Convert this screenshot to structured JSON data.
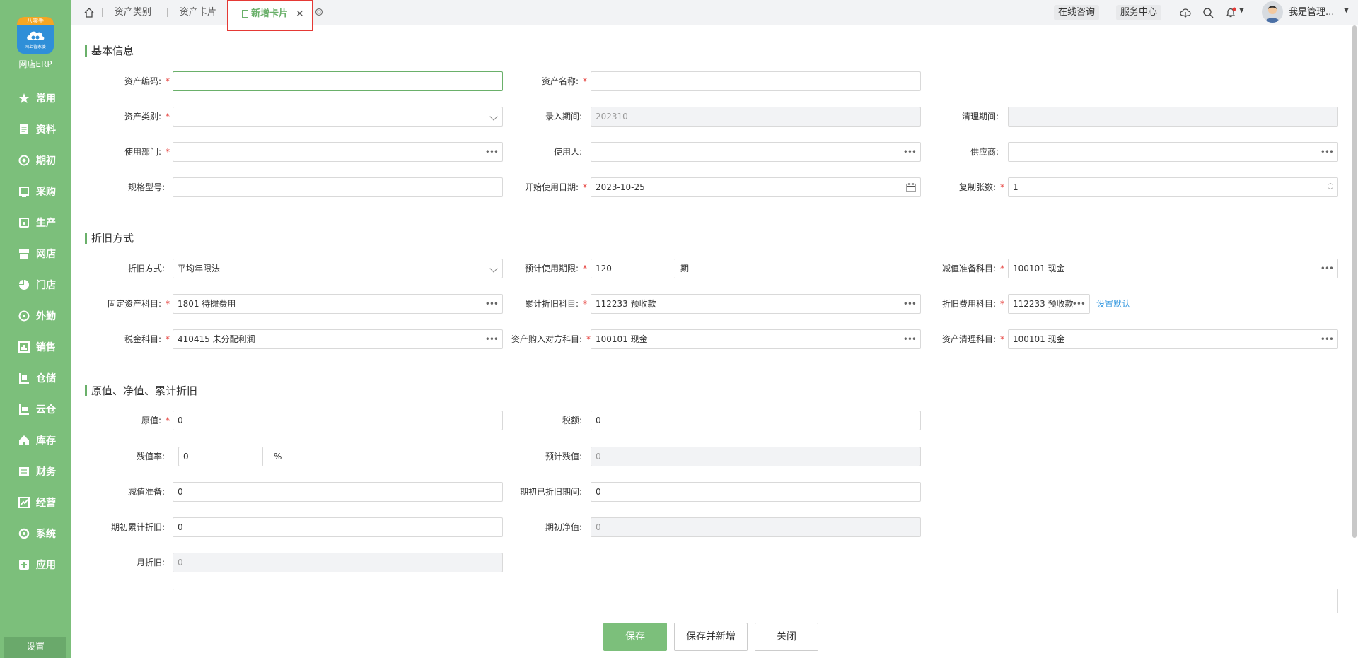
{
  "app": {
    "title": "网店ERP",
    "logo_ribbon": "八零手",
    "logo_sub": "网上管家婆"
  },
  "sidebar": {
    "items": [
      {
        "label": "常用",
        "icon": "star-icon"
      },
      {
        "label": "资料",
        "icon": "file-icon"
      },
      {
        "label": "期初",
        "icon": "target-icon"
      },
      {
        "label": "采购",
        "icon": "cart-icon"
      },
      {
        "label": "生产",
        "icon": "factory-icon"
      },
      {
        "label": "网店",
        "icon": "shop-icon"
      },
      {
        "label": "门店",
        "icon": "pie-icon"
      },
      {
        "label": "外勤",
        "icon": "location-icon"
      },
      {
        "label": "销售",
        "icon": "chart-icon"
      },
      {
        "label": "仓储",
        "icon": "warehouse-icon"
      },
      {
        "label": "云仓",
        "icon": "cloud-warehouse-icon"
      },
      {
        "label": "库存",
        "icon": "house-icon"
      },
      {
        "label": "财务",
        "icon": "money-icon"
      },
      {
        "label": "经营",
        "icon": "trend-icon"
      },
      {
        "label": "系统",
        "icon": "gear-icon"
      },
      {
        "label": "应用",
        "icon": "plus-box-icon"
      }
    ],
    "settings_label": "设置"
  },
  "tabs": {
    "items": [
      "资产类别",
      "资产卡片"
    ],
    "active": "新增卡片",
    "close": "✕"
  },
  "topbar": {
    "consult": "在线咨询",
    "service": "服务中心",
    "user": "我是管理...",
    "notify_color": "#e53935"
  },
  "sections": {
    "basic": "基本信息",
    "depreciation": "折旧方式",
    "values": "原值、净值、累计折旧"
  },
  "basic": {
    "asset_code": {
      "label": "资产编码:",
      "value": ""
    },
    "asset_name": {
      "label": "资产名称:",
      "value": ""
    },
    "asset_category": {
      "label": "资产类别:",
      "value": ""
    },
    "entry_period": {
      "label": "录入期间:",
      "value": "202310"
    },
    "clear_period": {
      "label": "清理期间:",
      "value": ""
    },
    "department": {
      "label": "使用部门:",
      "value": ""
    },
    "user": {
      "label": "使用人:",
      "value": ""
    },
    "supplier": {
      "label": "供应商:",
      "value": ""
    },
    "spec": {
      "label": "规格型号:",
      "value": ""
    },
    "start_date": {
      "label": "开始使用日期:",
      "value": "2023-10-25"
    },
    "copies": {
      "label": "复制张数:",
      "value": "1"
    }
  },
  "depr": {
    "method": {
      "label": "折旧方式:",
      "value": "平均年限法"
    },
    "life": {
      "label": "预计使用期限:",
      "value": "120",
      "unit": "期"
    },
    "impairment_acct": {
      "label": "减值准备科目:",
      "value": "100101 现金"
    },
    "fixed_acct": {
      "label": "固定资产科目:",
      "value": "1801 待摊费用"
    },
    "accum_acct": {
      "label": "累计折旧科目:",
      "value": "112233 预收款"
    },
    "expense_acct": {
      "label": "折旧费用科目:",
      "value": "112233 预收款",
      "link": "设置默认"
    },
    "tax_acct": {
      "label": "税金科目:",
      "value": "410415 未分配利润"
    },
    "purchase_acct": {
      "label": "资产购入对方科目:",
      "value": "100101 现金"
    },
    "clear_acct": {
      "label": "资产清理科目:",
      "value": "100101 现金"
    }
  },
  "values": {
    "original": {
      "label": "原值:",
      "value": "0"
    },
    "tax": {
      "label": "税额:",
      "value": "0"
    },
    "residual_rate": {
      "label": "残值率:",
      "value": "0",
      "unit": "%"
    },
    "est_residual": {
      "label": "预计残值:",
      "value": "0"
    },
    "impairment": {
      "label": "减值准备:",
      "value": "0"
    },
    "init_periods": {
      "label": "期初已折旧期间:",
      "value": "0"
    },
    "init_accum": {
      "label": "期初累计折旧:",
      "value": "0"
    },
    "init_net": {
      "label": "期初净值:",
      "value": "0"
    },
    "monthly": {
      "label": "月折旧:",
      "value": "0"
    }
  },
  "footer": {
    "save": "保存",
    "save_new": "保存并新增",
    "close": "关闭"
  },
  "colors": {
    "accent": "#7cbf7b",
    "required": "#e53935",
    "link": "#3a9be0"
  }
}
